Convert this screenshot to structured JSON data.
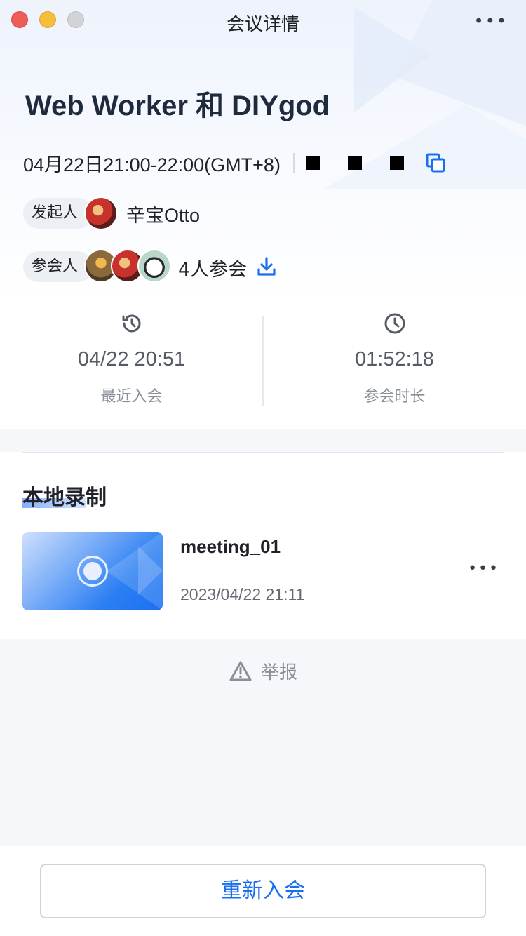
{
  "window": {
    "title": "会议详情",
    "more_label": "•••"
  },
  "meeting": {
    "title": "Web Worker 和 DIYgod",
    "time": "04月22日21:00-22:00(GMT+8)"
  },
  "host": {
    "chip_label": "发起人",
    "name": "辛宝Otto"
  },
  "participants": {
    "chip_label": "参会人",
    "count_text": "4人参会"
  },
  "stats": {
    "recent_join": {
      "value": "04/22 20:51",
      "label": "最近入会",
      "icon": "history-clock-icon"
    },
    "duration": {
      "value": "01:52:18",
      "label": "参会时长",
      "icon": "clock-icon"
    }
  },
  "recording": {
    "section_title": "本地录制",
    "files": [
      {
        "name": "meeting_01",
        "date": "2023/04/22 21:11",
        "more_label": "•••"
      }
    ]
  },
  "report": {
    "label": "举报",
    "icon": "warning-icon"
  },
  "footer": {
    "rejoin_label": "重新入会"
  },
  "colors": {
    "accent": "#1a6ff0",
    "traffic_red": "#ee5d57",
    "traffic_yellow": "#f4bd3a",
    "traffic_gray": "#d2d3d6"
  }
}
